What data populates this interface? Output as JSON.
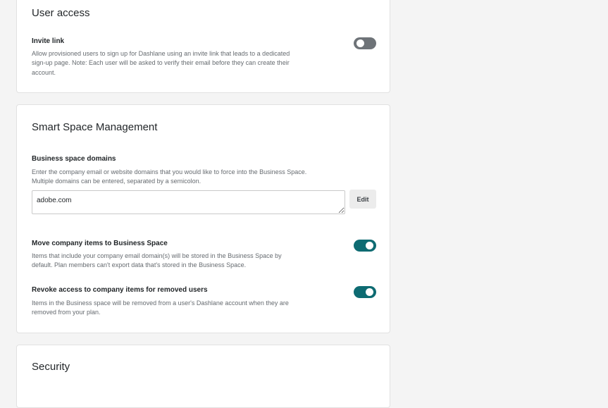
{
  "user_access": {
    "title": "User access",
    "invite_link": {
      "title": "Invite link",
      "description_lines": [
        "Allow provisioned users to sign up for Dashlane using an invite link that leads to a dedicated",
        "sign-up page. Note: Each user will be asked to verify their email before they can create their",
        "account."
      ],
      "enabled": false
    }
  },
  "smart_space": {
    "title": "Smart Space Management",
    "domains": {
      "title": "Business space domains",
      "description_lines": [
        "Enter the company email or website domains that you would like to force into the Business Space.",
        "Multiple domains can be entered, separated by a semicolon."
      ],
      "value": "adobe.com",
      "edit_label": "Edit"
    },
    "move_items": {
      "title": "Move company items to Business Space",
      "description_lines": [
        "Items that include your company email domain(s) will be stored in the Business Space by",
        "default. Plan members can't export data that's stored in the Business Space."
      ],
      "enabled": true
    },
    "revoke_access": {
      "title": "Revoke access to company items for removed users",
      "description_lines": [
        "Items in the Business space will be removed from a user's Dashlane account when they are",
        "removed from your plan."
      ],
      "enabled": true
    }
  },
  "security": {
    "title": "Security"
  },
  "colors": {
    "toggle_on": "#0e6b72",
    "toggle_off": "#6e7378",
    "background": "#f4f4f4",
    "card": "#ffffff"
  }
}
